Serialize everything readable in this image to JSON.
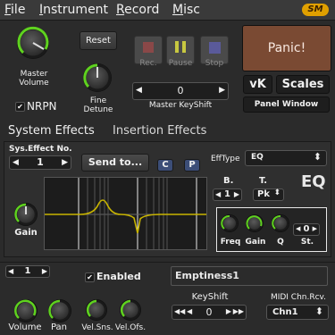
{
  "menu": {
    "file": {
      "u": "F",
      "rest": "ile"
    },
    "instrument": {
      "u": "I",
      "rest": "nstrument"
    },
    "record": {
      "u": "R",
      "rest": "ecord"
    },
    "misc": {
      "u": "M",
      "rest": "isc"
    },
    "badge": "SM"
  },
  "top": {
    "master_volume_label": "Master Volume",
    "nrpn_label": "NRPN",
    "nrpn_checked": "✔",
    "reset_label": "Reset",
    "fine_detune_label": "Fine Detune",
    "rec_label": "Rec.",
    "pause_label": "Pause",
    "stop_label": "Stop",
    "keyshift_value": "0",
    "keyshift_label": "Master KeyShift",
    "panic_label": "Panic!",
    "vk_label": "vK",
    "scales_label": "Scales",
    "panel_window_label": "Panel Window"
  },
  "tabs": {
    "system": "System Effects",
    "insertion": "Insertion Effects"
  },
  "effects": {
    "sys_effect_no_label": "Sys.Effect No.",
    "effect_no": "1",
    "send_to_label": "Send to...",
    "c_label": "C",
    "p_label": "P",
    "efftype_label": "EffType",
    "efftype_value": "EQ",
    "effect_title": "EQ",
    "gain_label": "Gain",
    "b_label": "B.",
    "b_value": "1",
    "t_label": "T.",
    "t_value": "Pk",
    "freq_label": "Freq",
    "band_gain_label": "Gain",
    "q_label": "Q",
    "st_label": "St.",
    "st_value": "0"
  },
  "part": {
    "part_no": "1",
    "enabled_label": "Enabled",
    "enabled_checked": "✔",
    "part_name": "Emptiness1",
    "volume_label": "Volume",
    "pan_label": "Pan",
    "velsns_label": "Vel.Sns.",
    "velofs_label": "Vel.Ofs.",
    "keyshift_label": "KeyShift",
    "keyshift_value": "0",
    "midi_chn_label": "MIDI Chn.Rcv.",
    "midi_chn_value": "Chn1"
  },
  "colors": {
    "accent_green": "#5fd21f",
    "panic_bg": "#7a4a33",
    "badge": "#e0a000",
    "eq_curve": "#c8b400"
  }
}
